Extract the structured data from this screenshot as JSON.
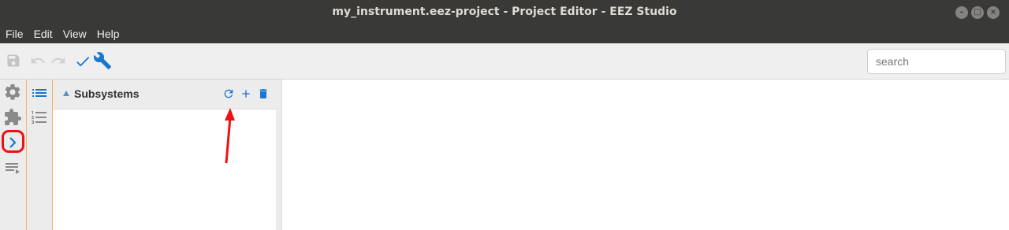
{
  "window": {
    "title": "my_instrument.eez-project - Project Editor - EEZ Studio"
  },
  "menu": {
    "items": [
      "File",
      "Edit",
      "View",
      "Help"
    ]
  },
  "toolbar": {
    "search_placeholder": "search",
    "buttons": [
      "save-icon",
      "undo-icon",
      "redo-icon",
      "check-icon",
      "wrench-icon"
    ]
  },
  "left_rail": {
    "icons": [
      "gear-icon",
      "puzzle-icon",
      "chevron-right-icon",
      "playlist-icon"
    ]
  },
  "second_rail": {
    "icons": [
      "list-icon",
      "numbered-list-icon"
    ]
  },
  "panel": {
    "title": "Subsystems",
    "actions": [
      "refresh-icon",
      "add-icon",
      "delete-icon"
    ]
  },
  "colors": {
    "accent": "#1976d2",
    "annotation": "#ee1111",
    "titlebar": "#393937"
  }
}
